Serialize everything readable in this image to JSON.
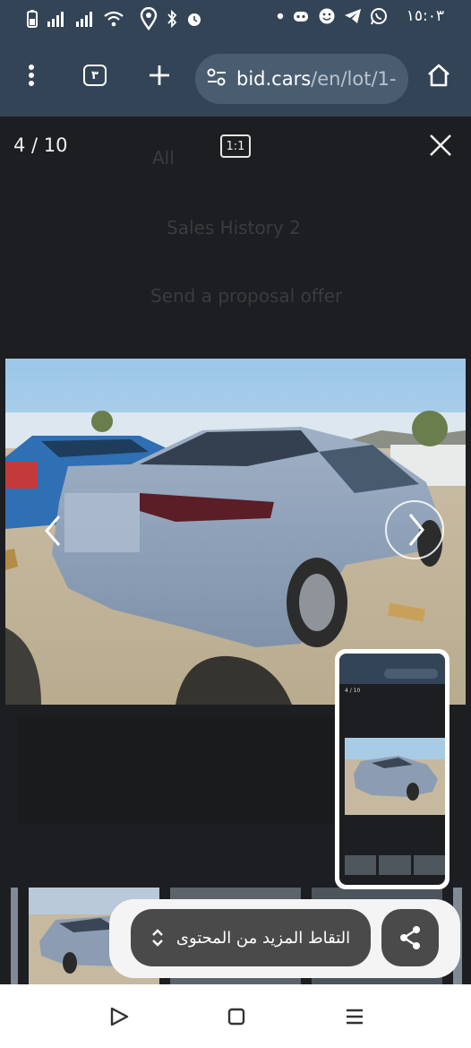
{
  "status_bar": {
    "time": "١٥:٠٣",
    "icons": [
      "battery-icon",
      "signal-icon",
      "signal-icon",
      "wifi-icon",
      "location-icon",
      "bluetooth-icon",
      "alarm-icon",
      "dot-icon",
      "game-icon",
      "emoji-icon",
      "telegram-icon",
      "whatsapp-icon"
    ]
  },
  "browser": {
    "tab_count": "٣",
    "url_domain": "bid.cars",
    "url_path": "/en/lot/1- "
  },
  "viewer": {
    "counter": "4 / 10",
    "ratio_label": "1:1",
    "background_texts": [
      "All",
      "Sales History 2",
      "Send a proposal offer"
    ]
  },
  "share_sheet": {
    "capture_more_label": "التقاط المزيد من المحتوى"
  },
  "preview": {
    "counter": "4 / 10"
  },
  "colors": {
    "toolbar": "#334456",
    "url_box": "#4a5d70",
    "viewer_bg": "#1d1e21",
    "share_button": "#4a4a4a"
  }
}
